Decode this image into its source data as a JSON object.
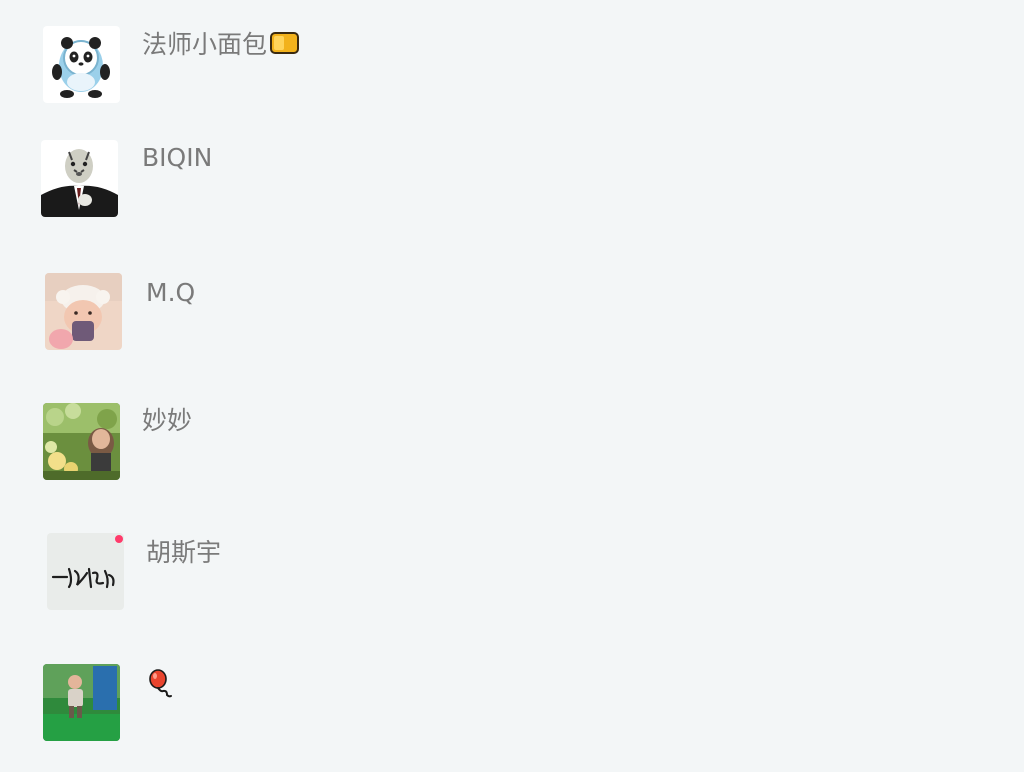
{
  "contacts": [
    {
      "name": "法师小面包",
      "avatar_icon": "panda-mascot-avatar",
      "badge_icon": "yellow-card-icon"
    },
    {
      "name": "BIQIN",
      "avatar_icon": "tiger-suit-avatar"
    },
    {
      "name": "M.Q",
      "avatar_icon": "baby-hat-avatar"
    },
    {
      "name": "妙妙",
      "avatar_icon": "garden-photo-avatar"
    },
    {
      "name": "胡斯宇",
      "avatar_icon": "calligraphy-avatar"
    },
    {
      "name": "",
      "avatar_icon": "child-outdoor-avatar",
      "badge_icon": "balloon-icon"
    }
  ]
}
